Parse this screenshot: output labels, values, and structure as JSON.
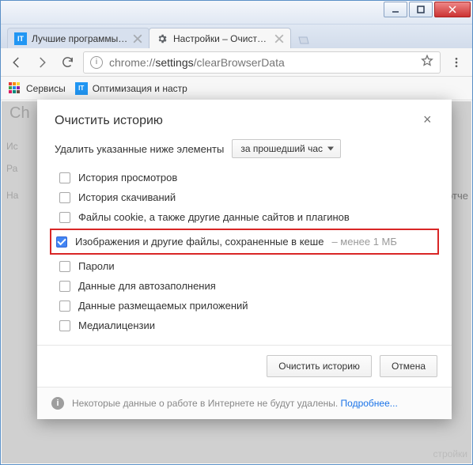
{
  "window": {
    "minimize_btn": "_",
    "maximize_btn": "□",
    "close_btn": "×"
  },
  "tabs": {
    "inactive": {
      "title": "Лучшие программы для",
      "favicon_text": "IT"
    },
    "active": {
      "title": "Настройки – Очистить и"
    }
  },
  "toolbar": {
    "url_prefix": "chrome://",
    "url_host": "settings",
    "url_path": "/clearBrowserData"
  },
  "bookmarks": {
    "apps_label": "Сервисы",
    "item1_label": "Оптимизация и настр",
    "item1_favicon": "IT"
  },
  "page": {
    "bg_left": "Ch",
    "bg_right": "и отче",
    "bg_corner": "стройки",
    "bg_l1": "Ис",
    "bg_l2": "Ра",
    "bg_l3": "На"
  },
  "dialog": {
    "title": "Очистить историю",
    "close": "×",
    "intro_text": "Удалить указанные ниже элементы",
    "dropdown_value": "за прошедший час",
    "options": [
      {
        "label": "История просмотров",
        "checked": false
      },
      {
        "label": "История скачиваний",
        "checked": false
      },
      {
        "label": "Файлы cookie, а также другие данные сайтов и плагинов",
        "checked": false
      },
      {
        "label": "Изображения и другие файлы, сохраненные в кеше",
        "checked": true,
        "hint": "– менее 1 МБ",
        "highlight": true
      },
      {
        "label": "Пароли",
        "checked": false
      },
      {
        "label": "Данные для автозаполнения",
        "checked": false
      },
      {
        "label": "Данные размещаемых приложений",
        "checked": false
      },
      {
        "label": "Медиалицензии",
        "checked": false
      }
    ],
    "btn_clear": "Очистить историю",
    "btn_cancel": "Отмена",
    "footer_text": "Некоторые данные о работе в Интернете не будут удалены. ",
    "footer_link": "Подробнее..."
  }
}
